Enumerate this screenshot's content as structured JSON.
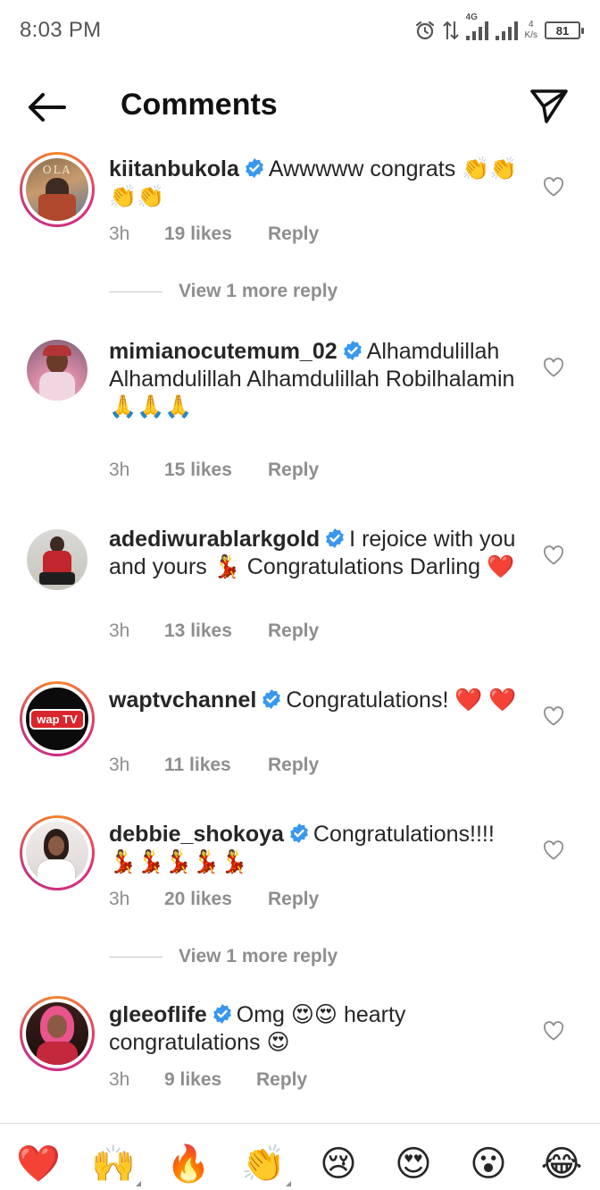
{
  "status_bar": {
    "time": "8:03 PM",
    "network_type": "4G",
    "speed_value": "4",
    "speed_unit": "K/s",
    "battery": "81"
  },
  "header": {
    "title": "Comments"
  },
  "comments": [
    {
      "username": "kiitanbukola",
      "text": "Awwwww congrats 👏👏👏👏",
      "time": "3h",
      "likes": "19 likes",
      "reply": "Reply",
      "view_more": "View 1 more reply",
      "avatar_text": "OLA"
    },
    {
      "username": "mimianocutemum_02",
      "text": "Alhamdulillah Alhamdulillah Alhamdulillah Robilhalamin 🙏🙏🙏",
      "time": "3h",
      "likes": "15 likes",
      "reply": "Reply"
    },
    {
      "username": "adediwurablarkgold",
      "text": "I rejoice with you and yours 💃 Congratulations Darling ❤️",
      "time": "3h",
      "likes": "13 likes",
      "reply": "Reply"
    },
    {
      "username": "waptvchannel",
      "text": "Congratulations! ❤️ ❤️",
      "time": "3h",
      "likes": "11 likes",
      "reply": "Reply",
      "avatar_text": "wap TV"
    },
    {
      "username": "debbie_shokoya",
      "text": "Congratulations!!!! 💃💃💃💃💃",
      "time": "3h",
      "likes": "20 likes",
      "reply": "Reply",
      "view_more": "View 1 more reply"
    },
    {
      "username": "gleeoflife",
      "text": "Omg 😍😍 hearty congratulations 😍",
      "time": "3h",
      "likes": "9 likes",
      "reply": "Reply"
    }
  ],
  "emoji_bar": [
    "❤️",
    "🙌",
    "🔥",
    "👏",
    "😢",
    "😍",
    "😮",
    "😂"
  ],
  "colors": {
    "verified_blue": "#3897f0",
    "meta_gray": "#8e8e8e",
    "ring_start": "#f58529",
    "ring_end": "#dd2a7b"
  }
}
